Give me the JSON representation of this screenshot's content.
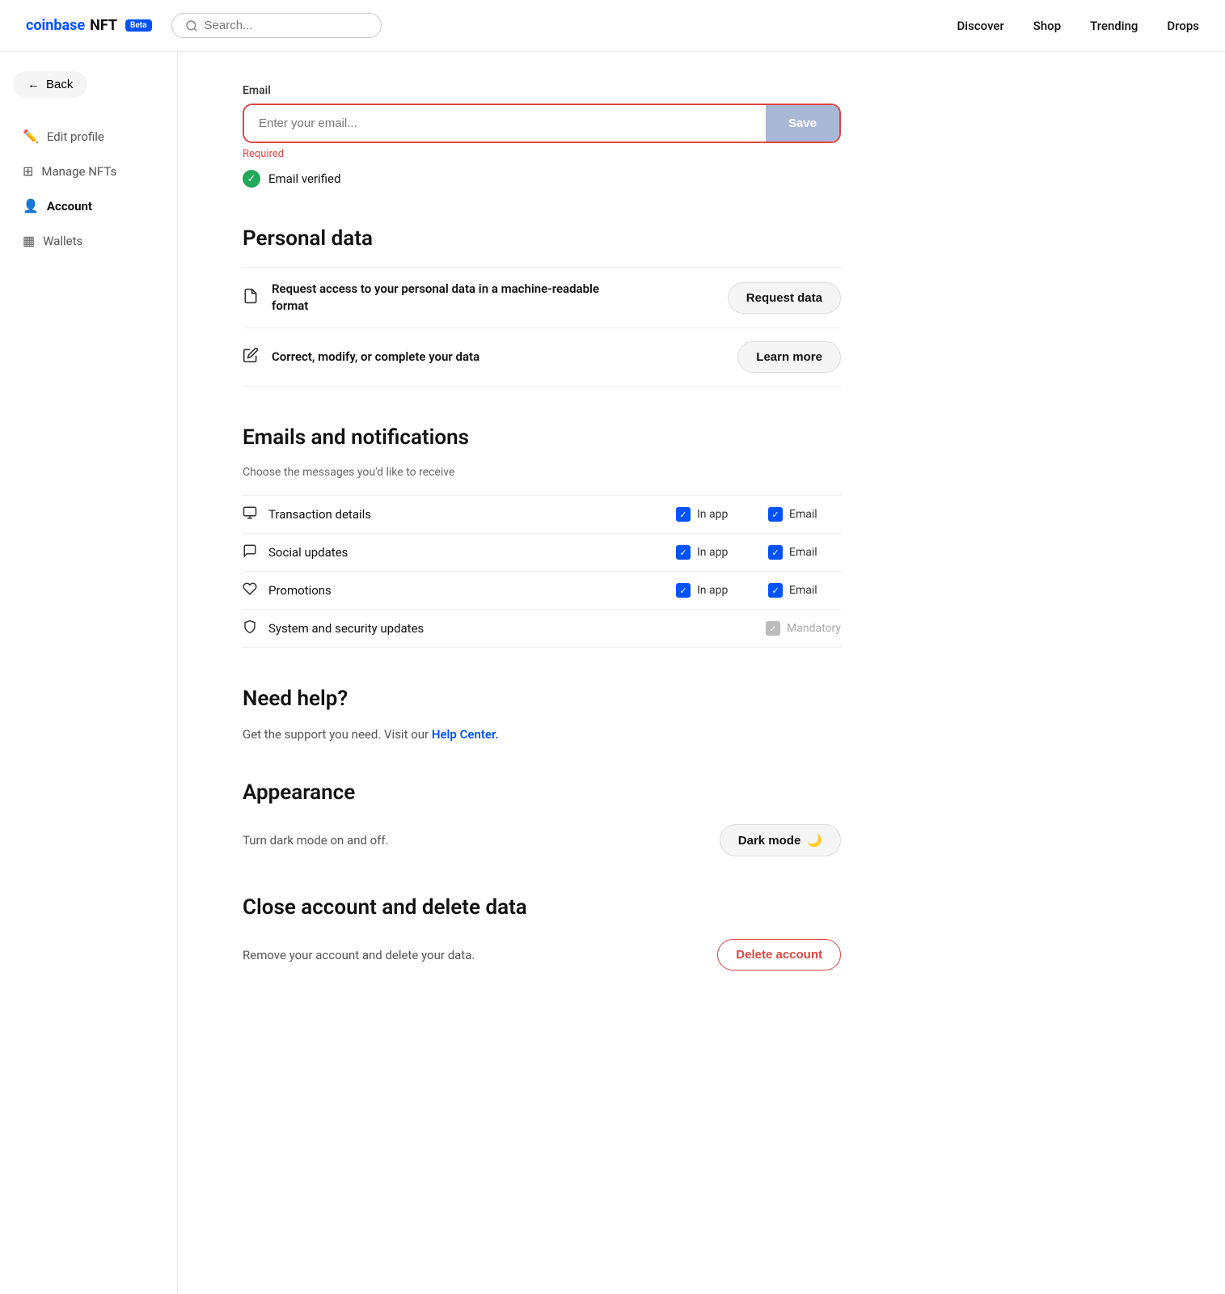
{
  "topnav": {
    "logo_coinbase": "coinbase",
    "logo_nft": "NFT",
    "beta_label": "Beta",
    "search_placeholder": "Search...",
    "nav_links": [
      "Discover",
      "Shop",
      "Trending",
      "Drops"
    ]
  },
  "sidebar": {
    "back_label": "Back",
    "items": [
      {
        "id": "edit-profile",
        "label": "Edit profile",
        "icon": "✏️"
      },
      {
        "id": "manage-nfts",
        "label": "Manage NFTs",
        "icon": "⊞"
      },
      {
        "id": "account",
        "label": "Account",
        "icon": "👤",
        "active": true
      },
      {
        "id": "wallets",
        "label": "Wallets",
        "icon": "▦"
      }
    ]
  },
  "main": {
    "email_section": {
      "label": "Email",
      "placeholder": "Enter your email...",
      "save_button": "Save",
      "required_text": "Required",
      "verified_text": "Email verified"
    },
    "personal_data": {
      "title": "Personal data",
      "rows": [
        {
          "icon": "📄",
          "text": "Request access to your personal data in a machine-readable format",
          "button": "Request data"
        },
        {
          "icon": "✏️",
          "text": "Correct, modify, or complete your data",
          "button": "Learn more"
        }
      ]
    },
    "notifications": {
      "title": "Emails and notifications",
      "subtitle": "Choose the messages you'd like to receive",
      "rows": [
        {
          "icon": "💬",
          "label": "Transaction details",
          "inapp": true,
          "email": true,
          "mandatory": false
        },
        {
          "icon": "💬",
          "label": "Social updates",
          "inapp": true,
          "email": true,
          "mandatory": false
        },
        {
          "icon": "◇",
          "label": "Promotions",
          "inapp": true,
          "email": true,
          "mandatory": false
        },
        {
          "icon": "🛡",
          "label": "System and security updates",
          "inapp": false,
          "email": false,
          "mandatory": true
        }
      ],
      "inapp_label": "In app",
      "email_label": "Email",
      "mandatory_label": "Mandatory"
    },
    "help": {
      "title": "Need help?",
      "text_before": "Get the support you need. Visit our ",
      "link_text": "Help Center.",
      "text_after": ""
    },
    "appearance": {
      "title": "Appearance",
      "text": "Turn dark mode on and off.",
      "button": "Dark mode",
      "button_icon": "🌙"
    },
    "delete": {
      "title": "Close account and delete data",
      "text": "Remove your account and delete your data.",
      "button": "Delete account"
    }
  }
}
